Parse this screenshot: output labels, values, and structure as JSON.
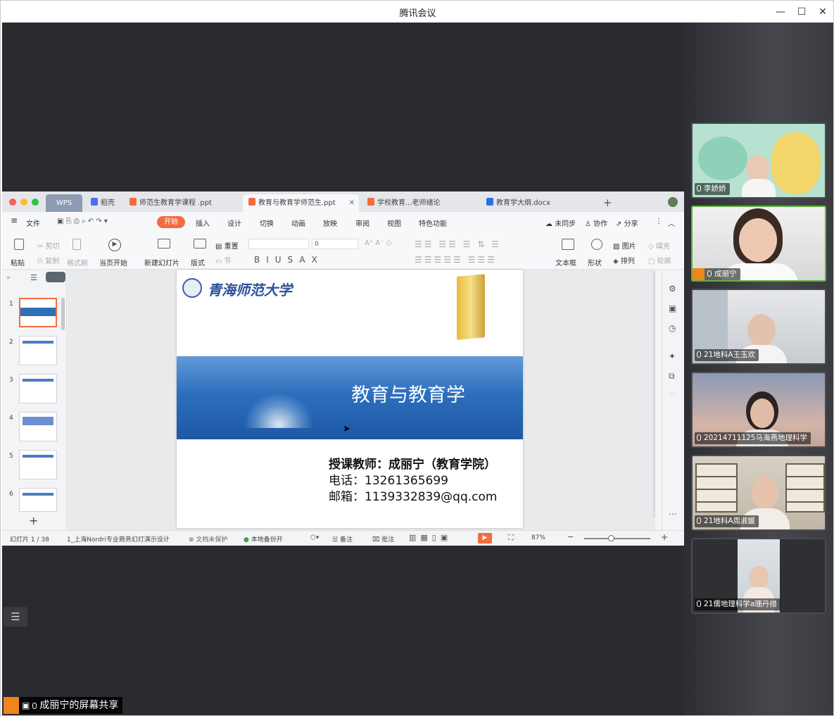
{
  "app": {
    "title": "腾讯会议"
  },
  "window_controls": {
    "minimize": "—",
    "maximize": "☐",
    "close": "✕"
  },
  "wps": {
    "tabs": [
      {
        "label": "WPS"
      },
      {
        "label": "稻壳"
      },
      {
        "label": "师范生教育学课程 .ppt"
      },
      {
        "label": "教育与教育学师范生.ppt"
      },
      {
        "label": "学校教育...老师绪论"
      },
      {
        "label": "教育学大纲.docx"
      }
    ],
    "new_tab": "+",
    "menu": {
      "file": "文件",
      "items": [
        "开始",
        "插入",
        "设计",
        "切换",
        "动画",
        "放映",
        "审阅",
        "视图",
        "特色功能"
      ],
      "right": [
        "未同步",
        "协作",
        "分享"
      ]
    },
    "ribbon": {
      "paste": "粘贴",
      "cut": "剪切",
      "copy": "复制",
      "format_painter": "格式刷",
      "from_start": "当页开始",
      "new_slide": "新建幻灯片",
      "layout": "版式",
      "reset": "重置",
      "section": "节",
      "font_size": "0",
      "text_box": "文本框",
      "shape": "形状",
      "picture": "图片",
      "arrange": "排列",
      "fill": "填充",
      "outline": "轮廓"
    },
    "slide_numbers": [
      "1",
      "2",
      "3",
      "4",
      "5",
      "6"
    ],
    "add_slide": "+",
    "slide": {
      "university": "青海师范大学",
      "banner_title": "教育与教育学",
      "teacher": "授课教师：成丽宁（教育学院）",
      "phone": "电话：13261365699",
      "email": "邮箱：1139332839@qq.com"
    },
    "status": {
      "slide_count": "幻灯片 1 / 38",
      "theme": "1_上海Nordri专业商务幻灯演示设计",
      "protect": "文档未保护",
      "backup": "本地备份开",
      "notes": "备注",
      "comment": "批注",
      "zoom": "87%"
    }
  },
  "participants": [
    {
      "name": "李娇娇"
    },
    {
      "name": "成丽宁"
    },
    {
      "name": "21地科A王玉欢"
    },
    {
      "name": "20214711125马海燕地理科学"
    },
    {
      "name": "21地科A周淑媛"
    },
    {
      "name": "21儒地理科学a珊丹措"
    }
  ],
  "share_label": "成丽宁的屏幕共享",
  "colors": {
    "accent": "#f46b3e",
    "speaking": "#5bb53c",
    "stage": "#2a2b2f"
  }
}
